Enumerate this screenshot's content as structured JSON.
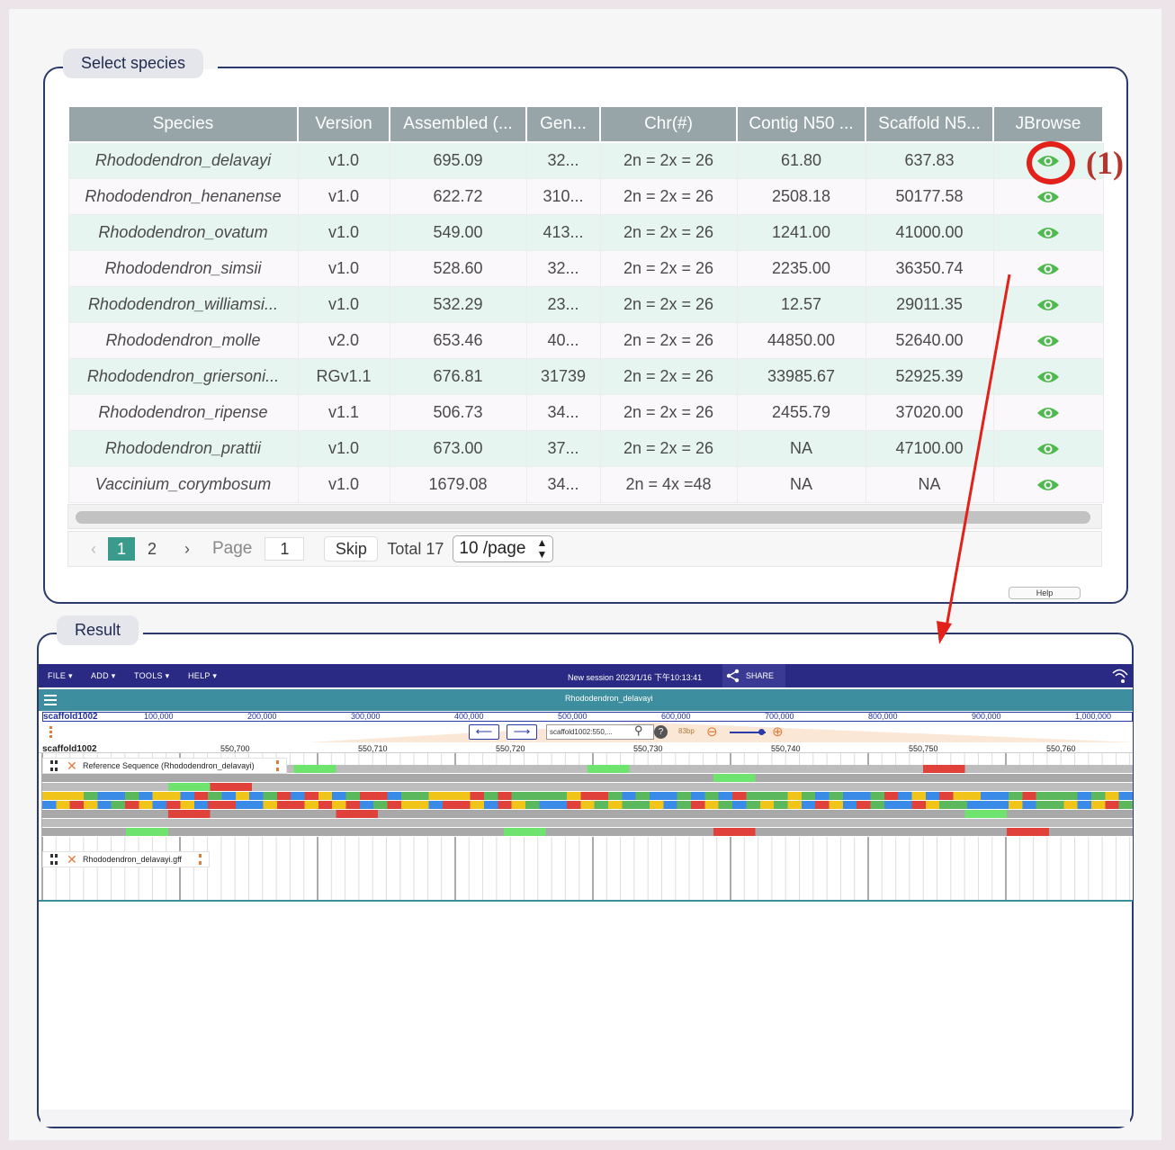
{
  "select_panel": {
    "legend": "Select species",
    "columns": [
      "Species",
      "Version",
      "Assembled (...",
      "Gen...",
      "Chr(#)",
      "Contig N50 ...",
      "Scaffold N5...",
      "JBrowse"
    ],
    "rows": [
      [
        "Rhododendron_delavayi",
        "v1.0",
        "695.09",
        "32...",
        "2n = 2x = 26",
        "61.80",
        "637.83"
      ],
      [
        "Rhododendron_henanense",
        "v1.0",
        "622.72",
        "310...",
        "2n = 2x = 26",
        "2508.18",
        "50177.58"
      ],
      [
        "Rhododendron_ovatum",
        "v1.0",
        "549.00",
        "413...",
        "2n = 2x = 26",
        "1241.00",
        "41000.00"
      ],
      [
        "Rhododendron_simsii",
        "v1.0",
        "528.60",
        "32...",
        "2n = 2x = 26",
        "2235.00",
        "36350.74"
      ],
      [
        "Rhododendron_williamsi...",
        "v1.0",
        "532.29",
        "23...",
        "2n = 2x = 26",
        "12.57",
        "29011.35"
      ],
      [
        "Rhododendron_molle",
        "v2.0",
        "653.46",
        "40...",
        "2n = 2x = 26",
        "44850.00",
        "52640.00"
      ],
      [
        "Rhododendron_griersoni...",
        "RGv1.1",
        "676.81",
        "31739",
        "2n = 2x = 26",
        "33985.67",
        "52925.39"
      ],
      [
        "Rhododendron_ripense",
        "v1.1",
        "506.73",
        "34...",
        "2n = 2x = 26",
        "2455.79",
        "37020.00"
      ],
      [
        "Rhododendron_prattii",
        "v1.0",
        "673.00",
        "37...",
        "2n = 2x = 26",
        "NA",
        "47100.00"
      ],
      [
        "Vaccinium_corymbosum",
        "v1.0",
        "1679.08",
        "34...",
        "2n = 4x =48",
        "NA",
        "NA"
      ]
    ],
    "jbrowse_icon": "eye-icon",
    "pagination": {
      "prev": "‹",
      "pages": [
        "1",
        "2"
      ],
      "current": "1",
      "next": "›",
      "page_label": "Page",
      "page_input": "1",
      "skip": "Skip",
      "total": "Total 17",
      "page_size": "10 /page"
    },
    "help": "Help"
  },
  "annotation": {
    "label": "(1)",
    "color": "#e2221a"
  },
  "result_panel": {
    "legend": "Result",
    "jbrowse": {
      "menus": [
        "FILE",
        "ADD",
        "TOOLS",
        "HELP"
      ],
      "session_title": "New session 2023/1/16 下午10:13:41",
      "share": "SHARE",
      "view_title": "Rhododendron_delavayi",
      "overview_ref": "scaffold1002",
      "overview_ticks": [
        "100,000",
        "200,000",
        "300,000",
        "400,000",
        "500,000",
        "600,000",
        "700,000",
        "800,000",
        "900,000",
        "1,000,000"
      ],
      "location": "scaffold1002:550,...",
      "bp": "83bp",
      "ruler_ref": "scaffold1002",
      "ruler_ticks": [
        "550,700",
        "550,710",
        "550,720",
        "550,730",
        "550,740",
        "550,750",
        "550,760"
      ],
      "tracks": [
        "Reference Sequence (Rhododendron_delavayi)",
        "Rhododendron_delavayi.gff"
      ],
      "colors": {
        "menubar": "#2a2a84",
        "viewbar": "#3d8e9e",
        "base_A": "#5cb85c",
        "base_C": "#3a8be8",
        "base_G": "#f0c419",
        "base_T": "#e0413a",
        "frame_gray": "#9a9a9a",
        "start_codon": "#6ee36e",
        "stop_codon": "#e0413a"
      }
    }
  }
}
